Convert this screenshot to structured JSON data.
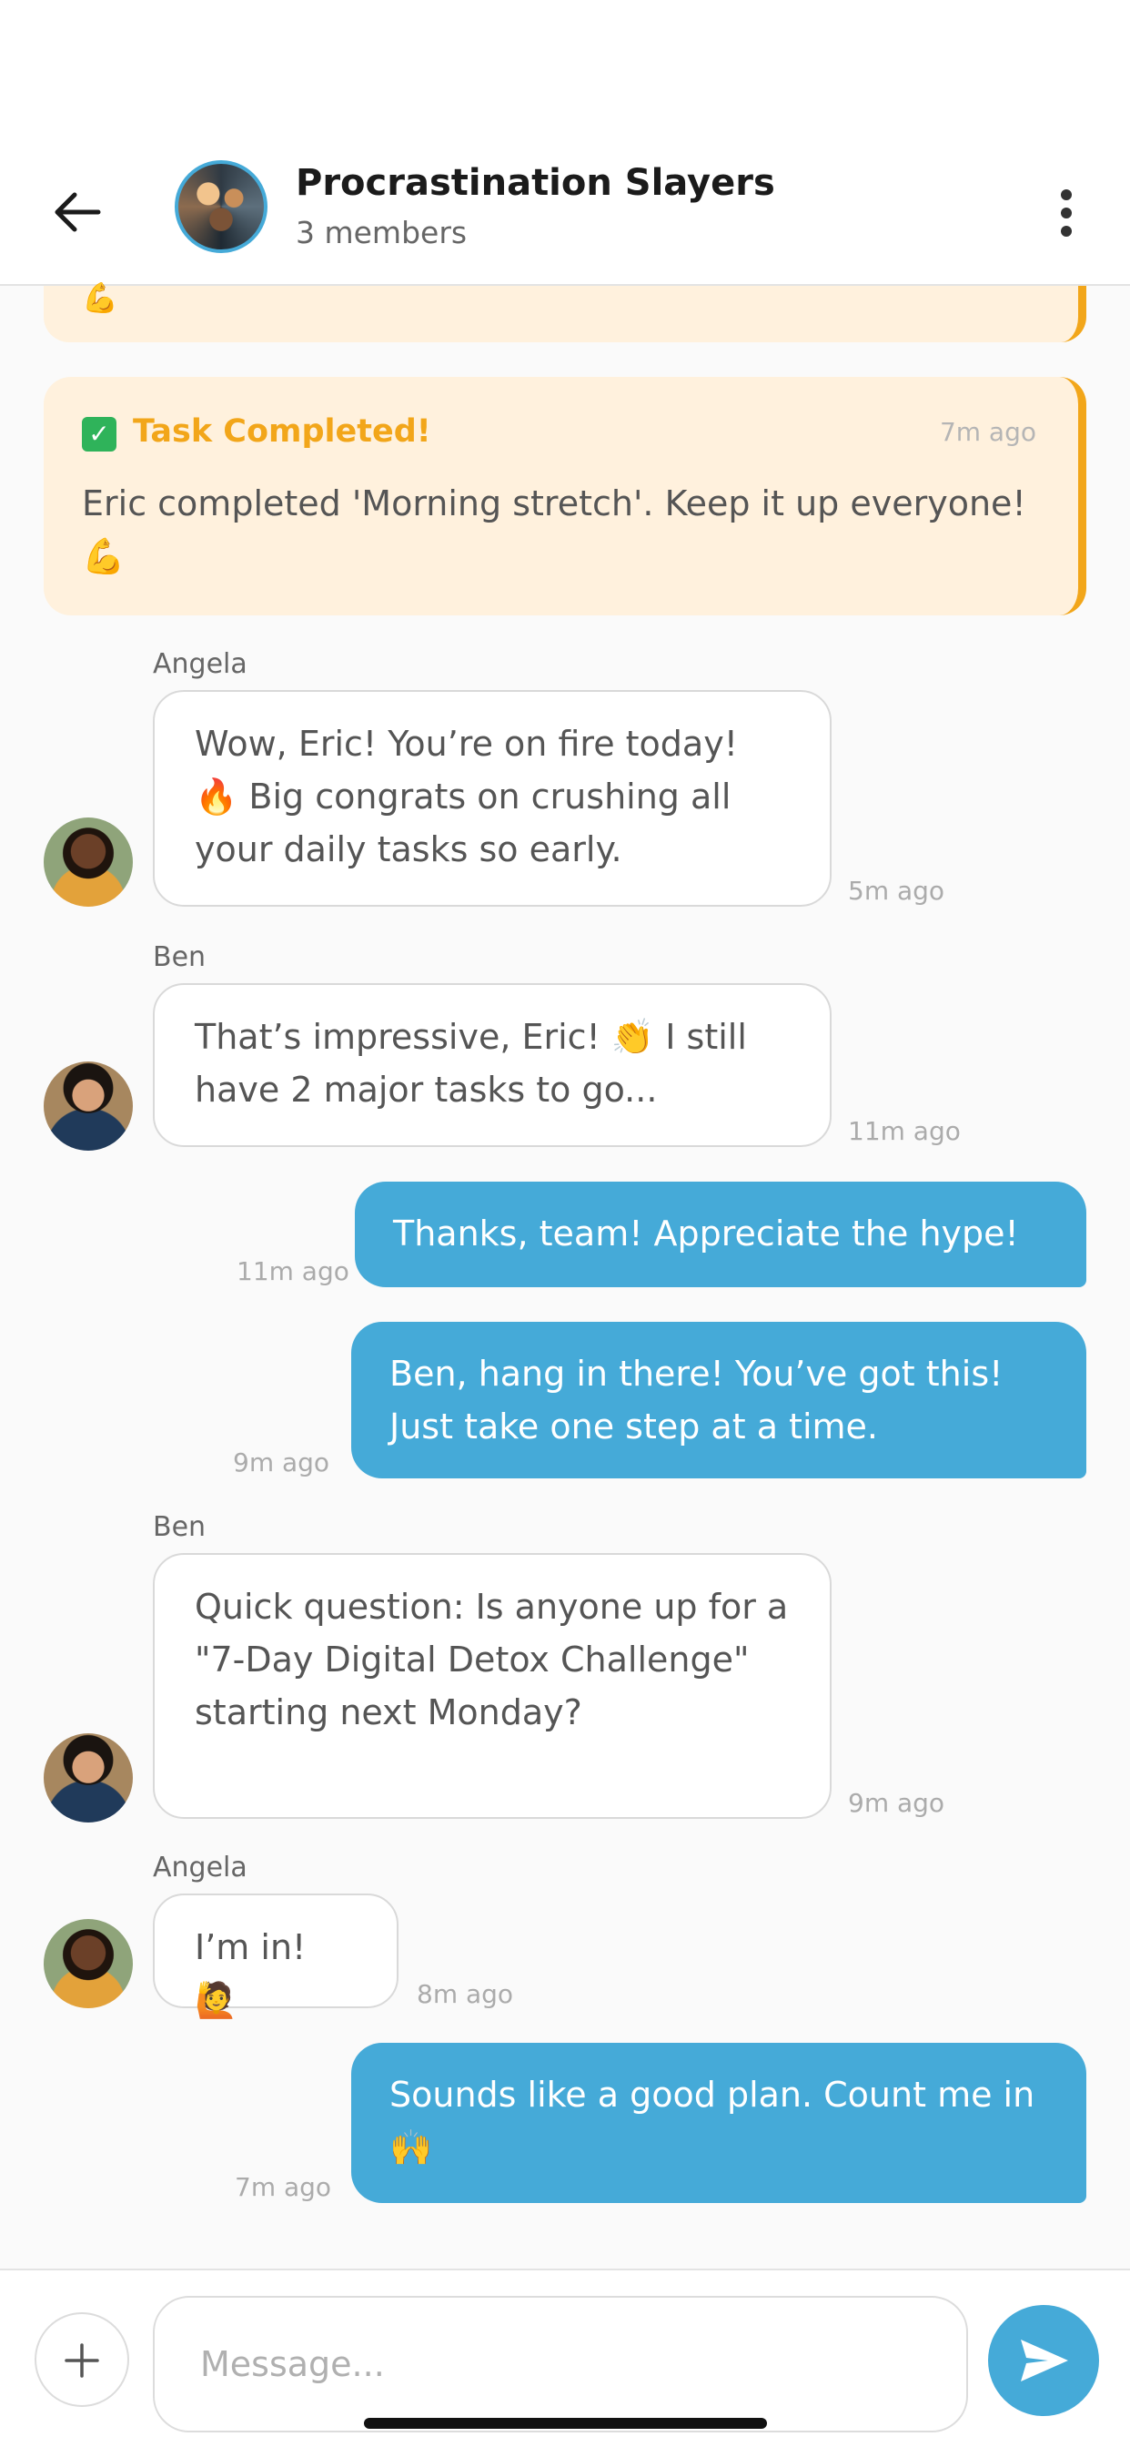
{
  "header": {
    "title": "Procrastination Slayers",
    "subtitle": "3 members"
  },
  "system_messages": [
    {
      "title": "Task Completed!",
      "time": "7m ago",
      "text": "Eric completed 'Morning stretch'. Keep it up everyone! 💪"
    }
  ],
  "top_card_partial": "💪",
  "messages": [
    {
      "sender": "Angela",
      "direction": "in",
      "text": "Wow, Eric! You’re on fire today! 🔥 Big congrats on crushing all your daily tasks so early.",
      "time": "5m ago"
    },
    {
      "sender": "Ben",
      "direction": "in",
      "text": "That’s impressive, Eric! 👏 I still have 2 major tasks to go...",
      "time": "11m ago"
    },
    {
      "sender": "",
      "direction": "out",
      "text": "Thanks, team! Appreciate the hype!",
      "time": "11m ago"
    },
    {
      "sender": "",
      "direction": "out",
      "text": "Ben, hang in there! You’ve got this! Just take one step at a time.",
      "time": "9m ago"
    },
    {
      "sender": "Ben",
      "direction": "in",
      "text": "Quick question: Is anyone up for a \"7-Day Digital Detox Challenge\" starting next Monday?",
      "time": "9m ago"
    },
    {
      "sender": "Angela",
      "direction": "in",
      "text": "I’m in! 🙋",
      "time": "8m ago"
    },
    {
      "sender": "",
      "direction": "out",
      "text": "Sounds like a good plan. Count me in 🙌",
      "time": "7m ago"
    }
  ],
  "composer": {
    "placeholder": "Message..."
  },
  "icons": {
    "back": "arrow-left-icon",
    "menu": "more-vertical-icon",
    "add": "plus-icon",
    "send": "send-icon",
    "check": "check-square-icon"
  },
  "colors": {
    "accent": "#45aad8",
    "system_bg": "#fff1dd",
    "system_accent": "#f2a61a"
  }
}
